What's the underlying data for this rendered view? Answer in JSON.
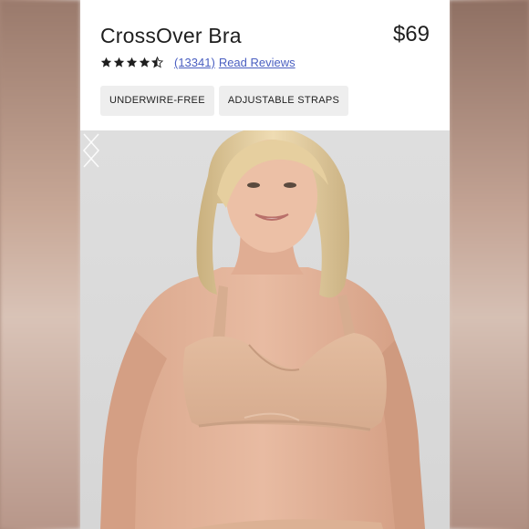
{
  "product": {
    "title": "CrossOver Bra",
    "price": "$69",
    "rating": 4.5,
    "rating_max": 5,
    "reviews_count": "(13341)",
    "reviews_link": "Read Reviews",
    "tags": [
      "UNDERWIRE-FREE",
      "ADJUSTABLE STRAPS"
    ]
  },
  "colors": {
    "star": "#1e1e1e",
    "link": "#4a5fc1",
    "tag_bg": "#eeeeee",
    "gallery_bg": "#dcdcdc",
    "skin": "#e2b299",
    "bra": "#ddb397",
    "hair": "#e8d3a8"
  },
  "gallery": {
    "prev_icon": "chevron-left-icon",
    "next_icon": "chevron-right-icon"
  }
}
